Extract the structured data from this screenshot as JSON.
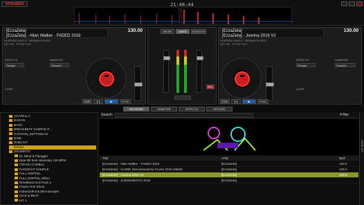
{
  "app": {
    "logo": "VirtualDJ",
    "clock": "21:48:44"
  },
  "colors": {
    "accent_red": "#c62020",
    "play_blue": "#1e5ea8",
    "selection_yellow": "#c9a21a",
    "selection_green": "#8c9a2c"
  },
  "deck_left": {
    "label": "[EzzaZeta]",
    "title": "[EzzaZeta] - Allan Walker - FADED 2016",
    "bpm": "130.00",
    "elapsed": "ELAPSED 00:00.0",
    "remain": "REMAIN 00:05.6",
    "key": "KEY Db",
    "pitch": "PITCH +0.0",
    "effects_label": "EFFECTS",
    "effect_value": "Flanger",
    "sampler_label": "SAMPLER",
    "sampler_value": "Sampler",
    "loop_label": "LOOP",
    "cue_label": "CUE",
    "sync_label": "SYNC",
    "in_label": "IN",
    "out_label": "OUT"
  },
  "deck_right": {
    "label": "[EzzaZeta]",
    "title": "[EzzaZeta] - Joenna 2016 V2",
    "bpm": "130.00",
    "elapsed": "ELAPSED 00:00.0",
    "remain": "REMAIN 00:05.6",
    "key": "KEY Db",
    "pitch": "PITCH +0.0",
    "effects_label": "EFFECTS",
    "effect_value": "Flanger",
    "sampler_label": "SAMPLER",
    "sampler_value": "Sampler",
    "loop_label": "LOOP",
    "cue_label": "CUE",
    "sync_label": "SYNC",
    "in_label": "IN",
    "out_label": "OUT"
  },
  "mixer": {
    "tabs": [
      "MIXER",
      "VIDEO",
      "SCRATCH"
    ],
    "active_tab": "VIDEO",
    "pfl": "PFL"
  },
  "browser": {
    "tabs": [
      "BROWSER",
      "SAMPLER",
      "EFFECTS",
      "RECORD"
    ],
    "active_tab": "BROWSER",
    "search_label": "Search:",
    "files_count": "4 files",
    "columns": {
      "title": "Title",
      "artist": "Artist",
      "bpm": "Bpm"
    },
    "sidelist_label": "SIDELIST"
  },
  "folders": [
    "ACAPELLA",
    "BAGAN",
    "BASS",
    "BREAKBEAT SAMPLE P...",
    "CATATAN_SETTINGAN",
    "DAW",
    "Drally KIT",
    "DRUM",
    "DRUMKITS",
    "Dr. Blind & Flangger",
    "Beat 8B funk Jwanstep 135 BPM",
    "CRASH CYMBAL",
    "DANGDUT SAMPLE",
    "FULL ROPPEL",
    "FULL ROPPEL Effect",
    "Breakbeat Kick Pack 1",
    "House One Shots",
    "IndoHardFunk Mini-Sampler",
    "KICK & BEAT",
    "KIT 1"
  ],
  "selected_folder": "DRUM",
  "files": [
    {
      "title": "[EzzaZeta] - Allan Walker - FADED 2016",
      "artist": "[EzzaZeta]",
      "bpm": "130.0"
    },
    {
      "title": "[EzzaZeta] - ALONE (NirvannaJazzy Cover) 2016 (NEW)",
      "artist": "[EzzaZeta]",
      "bpm": "128.0"
    },
    {
      "title": "[EzzaZeta] - Joenna 2016 V2",
      "artist": "[EzzaZeta]",
      "bpm": "130.0"
    },
    {
      "title": "[EzzaZeta] - JUDGEMENTS 2016",
      "artist": "[EzzaZeta]",
      "bpm": ""
    }
  ],
  "selected_file_index": 2
}
